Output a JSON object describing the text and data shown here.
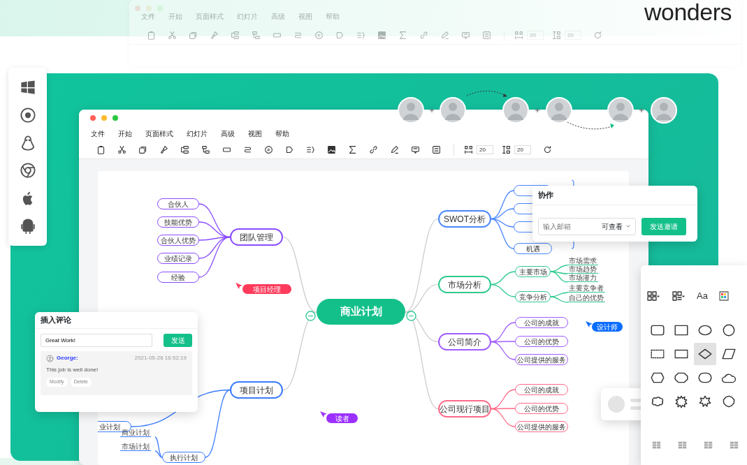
{
  "logo": {
    "text": "wonders"
  },
  "background_window": {
    "menu": [
      "文件",
      "开始",
      "页面样式",
      "幻灯片",
      "高级",
      "视图",
      "帮助"
    ],
    "spacing_values": [
      "20",
      "20"
    ]
  },
  "window": {
    "menu": [
      "文件",
      "开始",
      "页面样式",
      "幻灯片",
      "高级",
      "视图",
      "帮助"
    ],
    "spacing_values": [
      "20",
      "20"
    ]
  },
  "mindmap": {
    "center": {
      "label": "商业计划"
    },
    "branches": [
      {
        "label": "团队管理",
        "color": "#8b4dff",
        "children": [
          {
            "label": "合伙人"
          },
          {
            "label": "技能优势"
          },
          {
            "label": "合伙人优势"
          },
          {
            "label": "业绩记录"
          },
          {
            "label": "经验"
          }
        ]
      },
      {
        "label": "项目计划",
        "color": "#3a7bff",
        "children": [
          {
            "label": "业计划"
          },
          {
            "label": "执行计划",
            "children": [
              {
                "label": "商业计划"
              },
              {
                "label": "市场计划"
              }
            ]
          }
        ]
      },
      {
        "label": "SWOT分析",
        "color": "#4a86ff",
        "children": [
          {
            "label": "机遇"
          }
        ]
      },
      {
        "label": "市场分析",
        "color": "#2ec98e",
        "children": [
          {
            "label": "主要市场",
            "children": [
              {
                "label": "市场需求"
              },
              {
                "label": "市场趋势"
              },
              {
                "label": "市场潜力"
              }
            ]
          },
          {
            "label": "竞争分析",
            "children": [
              {
                "label": "主要竞争者"
              },
              {
                "label": "自己的优势"
              }
            ]
          }
        ]
      },
      {
        "label": "公司简介",
        "color": "#a05cff",
        "children": [
          {
            "label": "公司的成就"
          },
          {
            "label": "公司的优势"
          },
          {
            "label": "公司提供的服务"
          }
        ]
      },
      {
        "label": "公司现行项目",
        "color": "#ff6b8a",
        "children": [
          {
            "label": "公司的成就"
          },
          {
            "label": "公司的优势"
          },
          {
            "label": "公司提供的服务"
          }
        ]
      }
    ]
  },
  "cursors": [
    {
      "label": "项目经理",
      "color": "#ff3b5c"
    },
    {
      "label": "设计师",
      "color": "#0a6cff"
    },
    {
      "label": "读者",
      "color": "#9b30ff"
    }
  ],
  "collab_panel": {
    "title": "协作",
    "placeholder": "输入邮箱",
    "permission": "可查看",
    "button": "发送邀请"
  },
  "comment_panel": {
    "title": "插入评论",
    "input_value": "Great Work!",
    "button": "发送",
    "comment": {
      "author": "George:",
      "time": "2021-05-26 16:52:19",
      "text": "This job is well done!",
      "actions": [
        "Modify",
        "Delete"
      ]
    }
  },
  "shapes_panel": {
    "font_button": "Aa",
    "shapes": [
      {
        "selected": false
      },
      {
        "selected": false
      },
      {
        "selected": false
      },
      {
        "selected": false
      },
      {
        "selected": false
      },
      {
        "selected": false
      },
      {
        "selected": true
      },
      {
        "selected": false
      },
      {
        "selected": false
      },
      {
        "selected": false
      },
      {
        "selected": false
      },
      {
        "selected": false
      },
      {
        "selected": false
      },
      {
        "selected": false
      },
      {
        "selected": false
      },
      {
        "selected": false
      }
    ]
  }
}
